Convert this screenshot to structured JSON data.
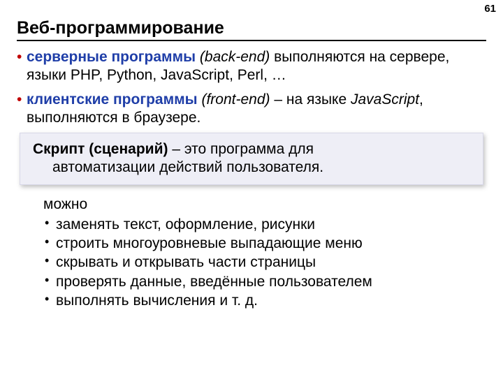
{
  "page_number": "61",
  "title": "Веб-программирование",
  "bullets": [
    {
      "hl": "серверные программы",
      "paren": "(back-end)",
      "rest": " выполняются на сервере, языки PHP, Python, JavaScript, Perl, …"
    },
    {
      "hl": "клиентские программы",
      "paren": "(front-end)",
      "rest": " – на языке ",
      "tail_it": "JavaScript",
      "tail": ", выполняются в браузере."
    }
  ],
  "callout": {
    "lead": "Скрипт (сценарий)",
    "rest_line1": " – это программа для",
    "line2": "автоматизации действий пользователя."
  },
  "sub": {
    "heading": "можно",
    "items": [
      "заменять текст, оформление, рисунки",
      "строить многоуровневые выпадающие меню",
      "скрывать и открывать части страницы",
      "проверять данные, введённые пользователем",
      "выполнять вычисления и т. д."
    ]
  }
}
